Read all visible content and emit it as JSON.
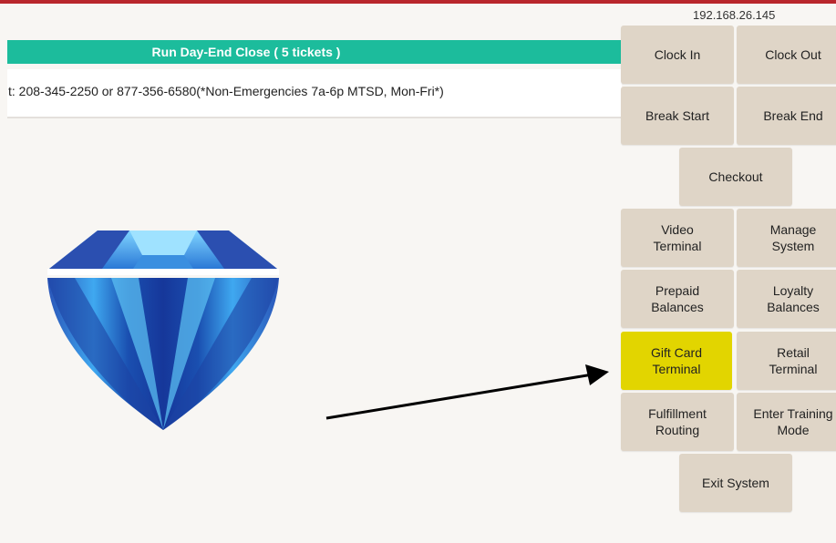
{
  "header": {
    "ip_address": "192.168.26.145",
    "accent_color": "#b9262c"
  },
  "banner": {
    "label": "Run Day-End Close ( 5 tickets )",
    "color": "#1cbc9c"
  },
  "support_text": "t: 208-345-2250 or 877-356-6580(*Non-Emergencies 7a-6p MTSD, Mon-Fri*)",
  "buttons": {
    "clock_in": "Clock In",
    "clock_out": "Clock Out",
    "break_start": "Break Start",
    "break_end": "Break End",
    "checkout": "Checkout",
    "video_terminal": "Video\nTerminal",
    "manage_system": "Manage\nSystem",
    "prepaid_balances": "Prepaid\nBalances",
    "loyalty_balances": "Loyalty\nBalances",
    "gift_card_terminal": "Gift Card\nTerminal",
    "retail_terminal": "Retail\nTerminal",
    "fulfillment_routing": "Fulfillment\nRouting",
    "enter_training_mode": "Enter Training\nMode",
    "exit_system": "Exit System"
  },
  "colors": {
    "button_bg": "#dfd5c7",
    "highlight_bg": "#e2d500"
  },
  "icons": {
    "logo": "diamond-logo-icon",
    "annotation": "arrow-annotation-icon"
  }
}
